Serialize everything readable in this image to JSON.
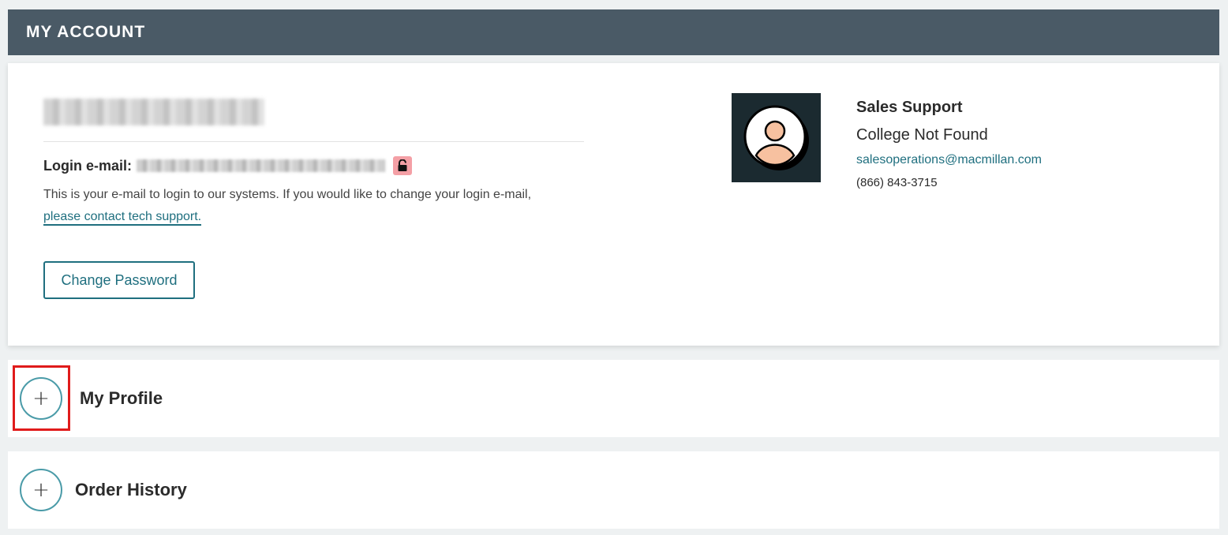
{
  "header": {
    "title": "MY ACCOUNT"
  },
  "account": {
    "login_label": "Login e-mail:",
    "help_text": "This is your e-mail to login to our systems. If you would like to change your login e-mail,",
    "help_link": "please contact tech support.",
    "change_password_label": "Change Password",
    "lock_icon": "unlock-icon",
    "lock_color": "#f4a0a6"
  },
  "support": {
    "name": "Sales Support",
    "college": "College Not Found",
    "email": "salesoperations@macmillan.com",
    "phone": "(866) 843-3715"
  },
  "sections": {
    "profile": {
      "title": "My Profile",
      "expand_icon": "+"
    },
    "orders": {
      "title": "Order History",
      "expand_icon": "+"
    }
  },
  "colors": {
    "header_bg": "#4a5a66",
    "accent": "#1f6f7f",
    "highlight": "#e01b1b"
  }
}
